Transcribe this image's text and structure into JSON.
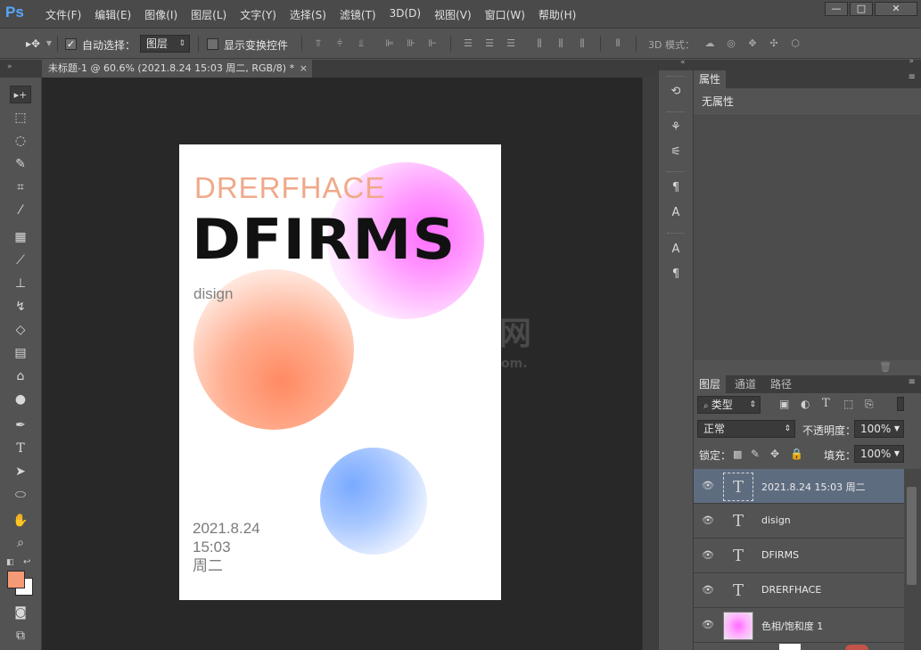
{
  "app": {
    "logo": "Ps"
  },
  "menu": [
    "文件(F)",
    "编辑(E)",
    "图像(I)",
    "图层(L)",
    "文字(Y)",
    "选择(S)",
    "滤镜(T)",
    "3D(D)",
    "视图(V)",
    "窗口(W)",
    "帮助(H)"
  ],
  "window_buttons": {
    "minimize": "—",
    "maximize": "□",
    "close": "✕"
  },
  "options": {
    "auto_select_label": "自动选择：",
    "auto_select_checked": true,
    "auto_select_value": "图层",
    "show_transform_label": "显示变换控件",
    "show_transform_checked": false,
    "mode_3d_label": "3D 模式："
  },
  "document_tab": {
    "title": "未标题-1 @ 60.6% (2021.8.24 15:03 周二, RGB/8) *",
    "close": "×"
  },
  "canvas": {
    "text_top": "DRERFHACE",
    "text_big": "DFIRMS",
    "text_sub": "disign",
    "date_lines": [
      "2021.8.24",
      "15:03",
      "周二"
    ],
    "watermark": "网",
    "watermark_sub": "om.",
    "colors": {
      "pink": "#ff6bff",
      "orange": "#ff8a62",
      "blue": "#79a9ff"
    }
  },
  "tools": [
    "move-tool",
    "marquee-tool",
    "lasso-tool",
    "quick-select-tool",
    "crop-tool",
    "eyedropper-tool",
    "healing-tool",
    "brush-tool",
    "stamp-tool",
    "history-brush-tool",
    "eraser-tool",
    "gradient-tool",
    "blur-tool",
    "dodge-tool",
    "pen-tool",
    "type-tool",
    "path-select-tool",
    "shape-tool",
    "hand-tool",
    "zoom-tool"
  ],
  "tool_glyphs": {
    "move-tool": "▸+",
    "type-tool": "T"
  },
  "swatches": {
    "foreground": "#f59a76",
    "background": "#ffffff"
  },
  "properties_panel": {
    "tab": "属性",
    "no_props": "无属性"
  },
  "layers_panel": {
    "tabs": [
      "图层",
      "通道",
      "路径"
    ],
    "filter_label": "类型",
    "blend_mode": "正常",
    "opacity_label": "不透明度：",
    "opacity_value": "100%",
    "lock_label": "锁定：",
    "fill_label": "填充：",
    "fill_value": "100%",
    "layers": [
      {
        "name": "2021.8.24  15:03 周二",
        "kind": "text",
        "selected": true
      },
      {
        "name": "disign",
        "kind": "text",
        "selected": false
      },
      {
        "name": "DFIRMS",
        "kind": "text",
        "selected": false
      },
      {
        "name": "DRERFHACE",
        "kind": "text",
        "selected": false
      },
      {
        "name": "色相/饱和度 1",
        "kind": "adjustment",
        "selected": false
      }
    ]
  }
}
